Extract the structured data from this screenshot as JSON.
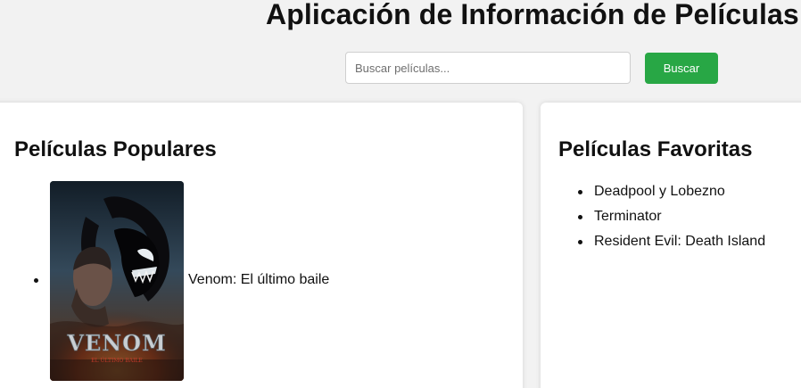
{
  "header": {
    "title": "Aplicación de Información de Películas"
  },
  "search": {
    "placeholder": "Buscar películas...",
    "value": "",
    "button_label": "Buscar",
    "button_color": "#28a745"
  },
  "popular": {
    "title": "Películas Populares",
    "movies": [
      {
        "title": "Venom: El último baile",
        "poster_text": "VENOM",
        "poster_subtitle": "EL ÚLTIMO BAILE"
      }
    ]
  },
  "favorites": {
    "title": "Películas Favoritas",
    "items": [
      "Deadpool y Lobezno",
      "Terminator",
      "Resident Evil: Death Island"
    ]
  }
}
